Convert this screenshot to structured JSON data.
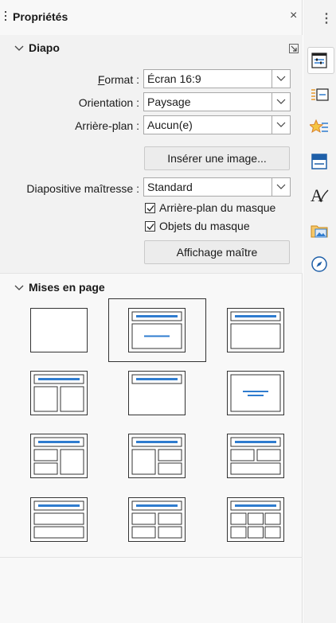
{
  "sidebar": {
    "title": "Propriétés",
    "close_glyph": "×",
    "more_glyph": "⋮"
  },
  "slide_section": {
    "title": "Diapo",
    "format": {
      "label_accel": "F",
      "label_rest": "ormat :",
      "value": "Écran 16:9"
    },
    "orientation": {
      "label": "Orientation :",
      "value": "Paysage"
    },
    "background": {
      "label": "Arrière-plan :",
      "value": "Aucun(e)"
    },
    "insert_image_button": "Insérer une image...",
    "master_slide": {
      "label": "Diapositive maîtresse :",
      "value": "Standard"
    },
    "master_background": {
      "label": "Arrière-plan du masque",
      "checked": true
    },
    "master_objects": {
      "label": "Objets du masque",
      "checked": true
    },
    "master_view_button": "Affichage maître"
  },
  "layouts_section": {
    "title": "Mises en page",
    "layouts": [
      {
        "id": "blank"
      },
      {
        "id": "title-content-centered",
        "selected": true
      },
      {
        "id": "title-content"
      },
      {
        "id": "title-2-content"
      },
      {
        "id": "title-only"
      },
      {
        "id": "centered-text"
      },
      {
        "id": "title-2content-content"
      },
      {
        "id": "title-content-2content"
      },
      {
        "id": "title-2content-over-content"
      },
      {
        "id": "title-content-over-content"
      },
      {
        "id": "title-4-content"
      },
      {
        "id": "title-6-content"
      }
    ]
  },
  "side_tabs": [
    {
      "name": "properties",
      "active": true
    },
    {
      "name": "slide-transition"
    },
    {
      "name": "animation"
    },
    {
      "name": "master-slides"
    },
    {
      "name": "styles"
    },
    {
      "name": "gallery"
    },
    {
      "name": "navigator"
    }
  ],
  "colors": {
    "accent": "#2f7ccf",
    "frame": "#333333"
  }
}
